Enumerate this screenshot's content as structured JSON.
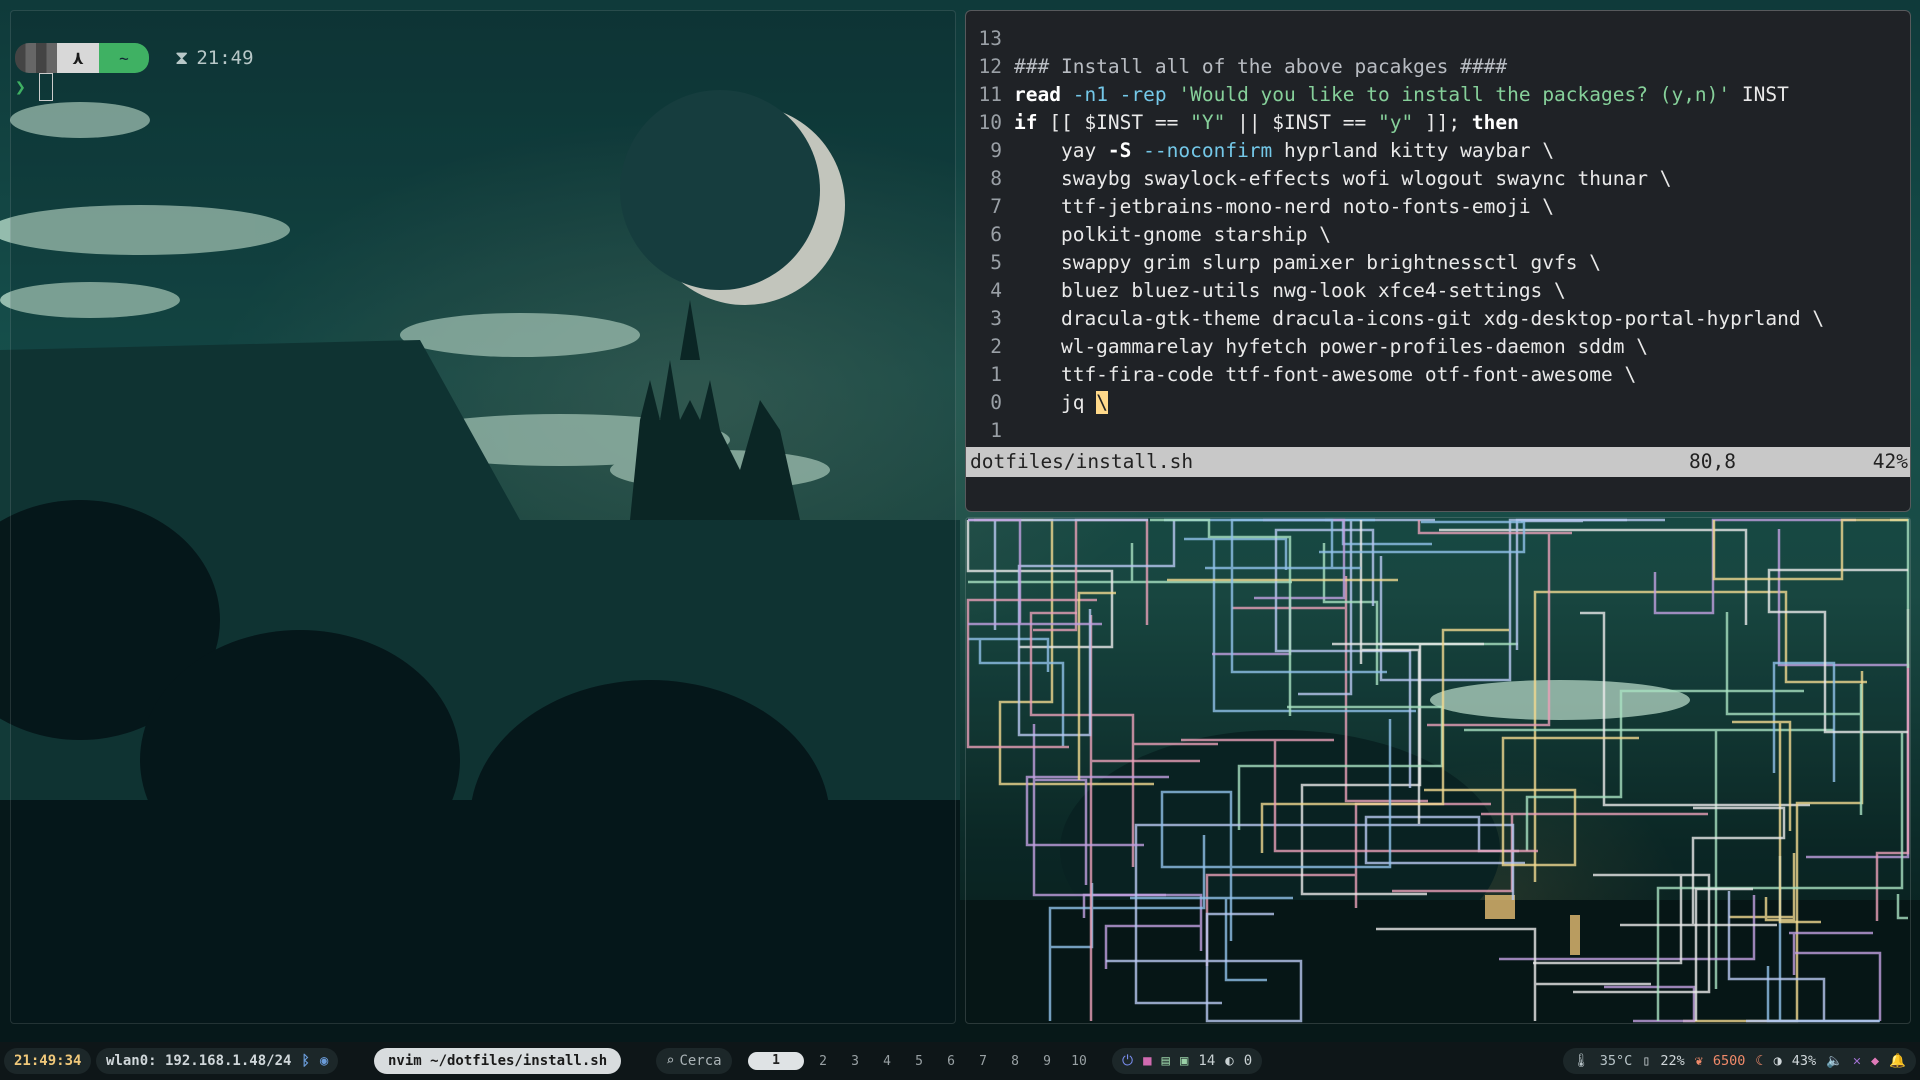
{
  "terminal_left": {
    "os_glyph": "⋏",
    "dir": "~",
    "time": "21:49",
    "prompt_char": "❯"
  },
  "editor": {
    "lines": [
      {
        "num": "13",
        "parts": []
      },
      {
        "num": "12",
        "parts": [
          {
            "t": "### Install all of the above pacakges ####",
            "c": "cmt"
          }
        ]
      },
      {
        "num": "11",
        "parts": [
          {
            "t": "read",
            "c": "kw"
          },
          {
            "t": " -n1 -rep ",
            "c": "opt"
          },
          {
            "t": "'Would you like to install the packages? (y,n)'",
            "c": "str"
          },
          {
            "t": " INST",
            "c": ""
          }
        ]
      },
      {
        "num": "10",
        "parts": [
          {
            "t": "if",
            "c": "kw"
          },
          {
            "t": " [[ $INST == ",
            "c": ""
          },
          {
            "t": "\"Y\"",
            "c": "str"
          },
          {
            "t": " || $INST == ",
            "c": ""
          },
          {
            "t": "\"y\"",
            "c": "str"
          },
          {
            "t": " ]]; ",
            "c": ""
          },
          {
            "t": "then",
            "c": "kw"
          }
        ]
      },
      {
        "num": "9",
        "parts": [
          {
            "t": "    yay ",
            "c": ""
          },
          {
            "t": "-S",
            "c": "kw"
          },
          {
            "t": " --noconfirm",
            "c": "opt"
          },
          {
            "t": " hyprland kitty waybar \\",
            "c": ""
          }
        ]
      },
      {
        "num": "8",
        "parts": [
          {
            "t": "    swaybg swaylock-effects wofi wlogout swaync thunar \\",
            "c": ""
          }
        ]
      },
      {
        "num": "7",
        "parts": [
          {
            "t": "    ttf-jetbrains-mono-nerd noto-fonts-emoji \\",
            "c": ""
          }
        ]
      },
      {
        "num": "6",
        "parts": [
          {
            "t": "    polkit-gnome starship \\",
            "c": ""
          }
        ]
      },
      {
        "num": "5",
        "parts": [
          {
            "t": "    swappy grim slurp pamixer brightnessctl gvfs \\",
            "c": ""
          }
        ]
      },
      {
        "num": "4",
        "parts": [
          {
            "t": "    bluez bluez-utils nwg-look xfce4-settings \\",
            "c": ""
          }
        ]
      },
      {
        "num": "3",
        "parts": [
          {
            "t": "    dracula-gtk-theme dracula-icons-git xdg-desktop-portal-hyprland \\",
            "c": ""
          }
        ]
      },
      {
        "num": "2",
        "parts": [
          {
            "t": "    wl-gammarelay hyfetch power-profiles-daemon sddm \\",
            "c": ""
          }
        ]
      },
      {
        "num": "1",
        "parts": [
          {
            "t": "    ttf-fira-code ttf-font-awesome otf-font-awesome \\",
            "c": ""
          }
        ]
      },
      {
        "num": "0",
        "parts": [
          {
            "t": "    jq ",
            "c": ""
          },
          {
            "t": "\\",
            "c": "cur"
          }
        ]
      },
      {
        "num": "1",
        "parts": []
      }
    ],
    "status": {
      "file": "dotfiles/install.sh",
      "pos": "80,8",
      "pct": "42%"
    }
  },
  "bar": {
    "clock": "21:49:34",
    "network": "wlan0: 192.168.1.48/24",
    "window_title": "nvim ~/dotfiles/install.sh",
    "search_label": "Cerca",
    "workspaces": [
      "1",
      "2",
      "3",
      "4",
      "5",
      "6",
      "7",
      "8",
      "9",
      "10"
    ],
    "active_workspace": "1",
    "updates": "14",
    "notifications_count": "0",
    "temperature": "35°C",
    "battery": "22%",
    "color_temp": "6500",
    "brightness": "43%"
  },
  "colors": {
    "pipes": [
      "#e8a0b8",
      "#a8e0c0",
      "#b8c8f0",
      "#f0d890",
      "#e8e8e8",
      "#c0a0e0",
      "#90c0e8"
    ]
  }
}
